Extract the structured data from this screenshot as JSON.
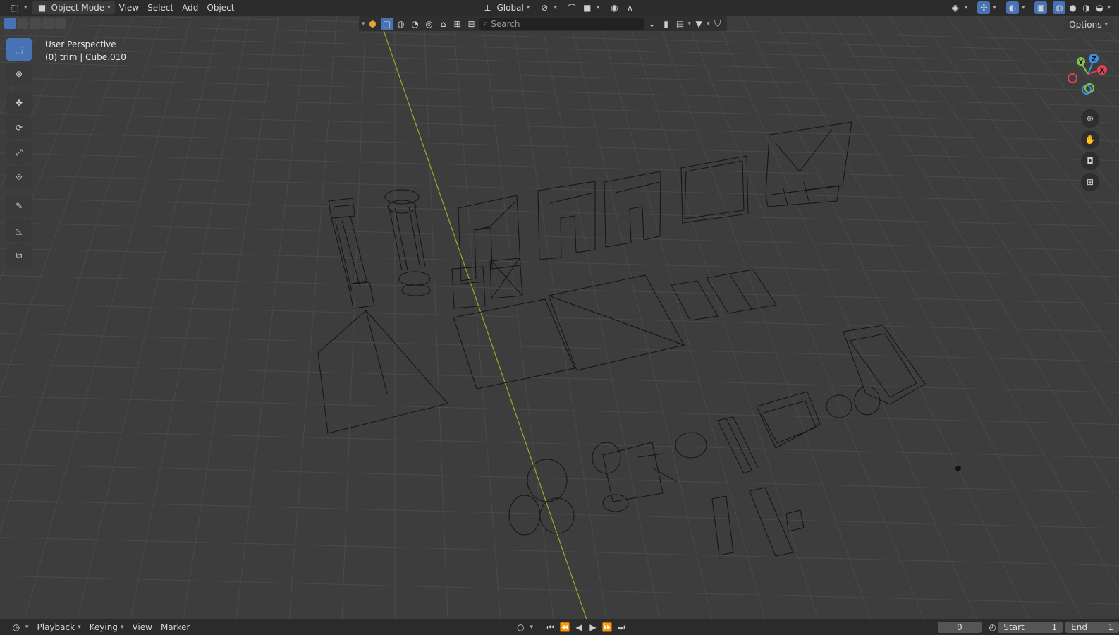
{
  "header": {
    "mode": "Object Mode",
    "menus": [
      "View",
      "Select",
      "Add",
      "Object"
    ],
    "transform_orientation": "Global",
    "options": "Options"
  },
  "viewport": {
    "perspective": "User Perspective",
    "active_object": "(0) trim | Cube.010",
    "search_placeholder": "Search",
    "gizmo": {
      "z": "Z",
      "y": "Y",
      "x": "X"
    }
  },
  "timeline": {
    "menus": [
      "Playback",
      "Keying",
      "View",
      "Marker"
    ],
    "current_frame": "0",
    "start_label": "Start",
    "start_value": "1",
    "end_label": "End",
    "end_value": "1"
  },
  "colors": {
    "accent": "#4772b3",
    "y_axis_line": "#8bb32a",
    "x_axis": "#e0424f",
    "y_axis": "#8bc34a",
    "z_axis": "#3d8fe0"
  }
}
